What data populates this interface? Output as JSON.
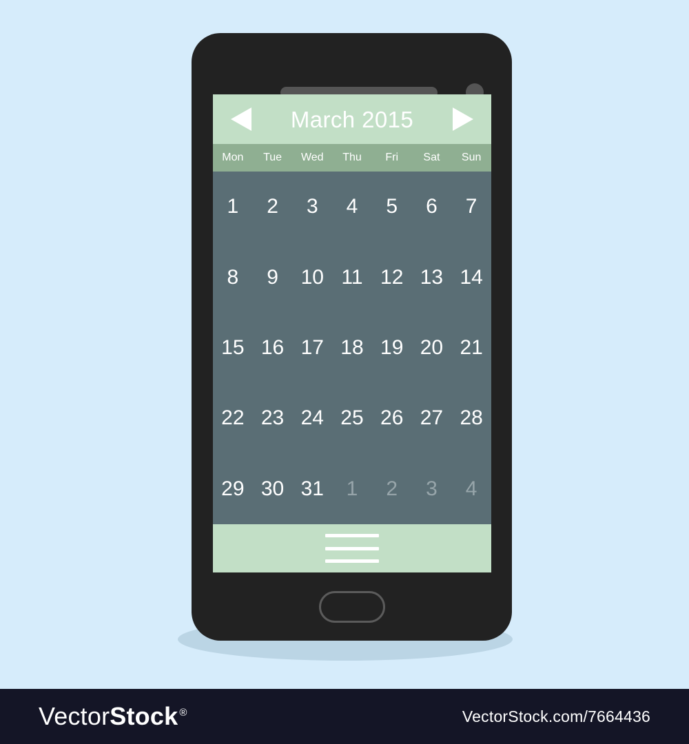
{
  "page": {
    "background_color": "#d6ecfb"
  },
  "device": {
    "name": "smartphone",
    "body_color": "#222222",
    "speaker_label": "earpiece-speaker",
    "camera_label": "front-camera",
    "home_button_label": "home-button",
    "shadow_color": "#b9d3e3"
  },
  "calendar": {
    "header": {
      "title": "March 2015",
      "prev_icon": "triangle-left-icon",
      "next_icon": "triangle-right-icon",
      "background_color": "#c2dfc6",
      "title_color": "#ffffff"
    },
    "weekdays": [
      "Mon",
      "Tue",
      "Wed",
      "Thu",
      "Fri",
      "Sat",
      "Sun"
    ],
    "weekday_bar_color": "#8faf92",
    "grid_background_color": "#5a6e75",
    "day_color": "#ffffff",
    "muted_day_color": "#97a5aa",
    "weeks": [
      [
        {
          "label": "1",
          "muted": false
        },
        {
          "label": "2",
          "muted": false
        },
        {
          "label": "3",
          "muted": false
        },
        {
          "label": "4",
          "muted": false
        },
        {
          "label": "5",
          "muted": false
        },
        {
          "label": "6",
          "muted": false
        },
        {
          "label": "7",
          "muted": false
        }
      ],
      [
        {
          "label": "8",
          "muted": false
        },
        {
          "label": "9",
          "muted": false
        },
        {
          "label": "10",
          "muted": false
        },
        {
          "label": "11",
          "muted": false
        },
        {
          "label": "12",
          "muted": false
        },
        {
          "label": "13",
          "muted": false
        },
        {
          "label": "14",
          "muted": false
        }
      ],
      [
        {
          "label": "15",
          "muted": false
        },
        {
          "label": "16",
          "muted": false
        },
        {
          "label": "17",
          "muted": false
        },
        {
          "label": "18",
          "muted": false
        },
        {
          "label": "19",
          "muted": false
        },
        {
          "label": "20",
          "muted": false
        },
        {
          "label": "21",
          "muted": false
        }
      ],
      [
        {
          "label": "22",
          "muted": false
        },
        {
          "label": "23",
          "muted": false
        },
        {
          "label": "24",
          "muted": false
        },
        {
          "label": "25",
          "muted": false
        },
        {
          "label": "26",
          "muted": false
        },
        {
          "label": "27",
          "muted": false
        },
        {
          "label": "28",
          "muted": false
        }
      ],
      [
        {
          "label": "29",
          "muted": false
        },
        {
          "label": "30",
          "muted": false
        },
        {
          "label": "31",
          "muted": false
        },
        {
          "label": "1",
          "muted": true
        },
        {
          "label": "2",
          "muted": true
        },
        {
          "label": "3",
          "muted": true
        },
        {
          "label": "4",
          "muted": true
        }
      ]
    ],
    "bottom_bar": {
      "menu_icon": "hamburger-menu-icon",
      "background_color": "#c2dfc6",
      "line_count": 3
    }
  },
  "watermark": {
    "brand_light": "Vector",
    "brand_bold": "Stock",
    "registered_mark": "®",
    "url": "VectorStock.com/7664436",
    "background_color": "#141526"
  }
}
